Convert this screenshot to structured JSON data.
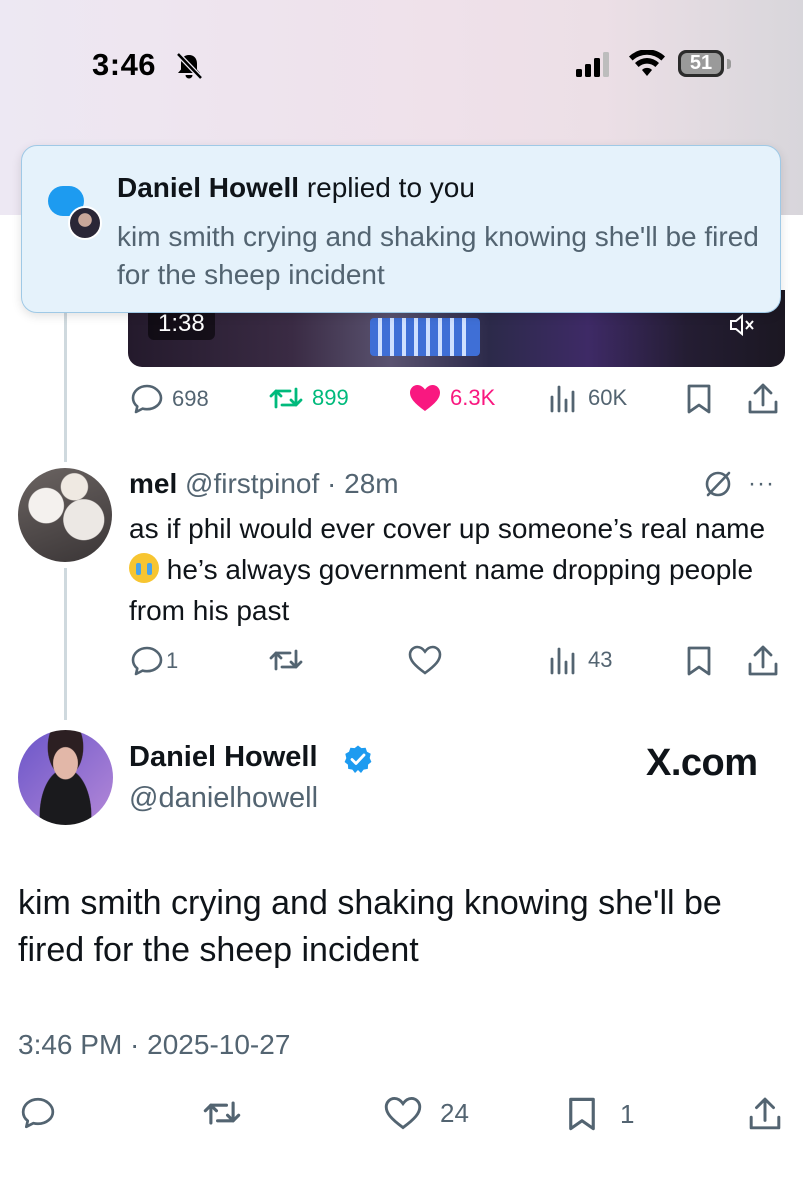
{
  "status_bar": {
    "time": "3:46",
    "battery": "51"
  },
  "video": {
    "duration": "1:38"
  },
  "notification": {
    "author": "Daniel Howell",
    "action": " replied to you",
    "body": "kim smith crying and shaking knowing she'll be fired for the sheep incident"
  },
  "original_tweet_actions": {
    "replies": "698",
    "reposts": "899",
    "likes": "6.3K",
    "views": "60K"
  },
  "reply": {
    "name": "mel",
    "meta": " @firstpinof · 28m",
    "text_before_emoji": "as if phil would ever cover up someone’s real name ",
    "text_after_emoji": " he’s always government name dropping people from his past",
    "replies": "1",
    "views": "43",
    "more": "···"
  },
  "main_tweet": {
    "name": "Daniel Howell",
    "handle": "@danielhowell",
    "watermark": "X.com",
    "text": "kim smith crying and shaking knowing she'll be fired for the sheep incident",
    "timestamp": "3:46 PM · 2025-10-27",
    "likes": "24",
    "bookmarks": "1"
  },
  "colors": {
    "accent": "#1d9bf0",
    "repost": "#00ba7c",
    "like": "#f91880",
    "muted_text": "#536471"
  },
  "icons": [
    "bell-slash-icon",
    "signal-icon",
    "wifi-icon",
    "battery-icon",
    "reply-icon",
    "repost-icon",
    "heart-icon",
    "views-icon",
    "bookmark-icon",
    "share-icon",
    "mute-icon",
    "verified-icon"
  ]
}
